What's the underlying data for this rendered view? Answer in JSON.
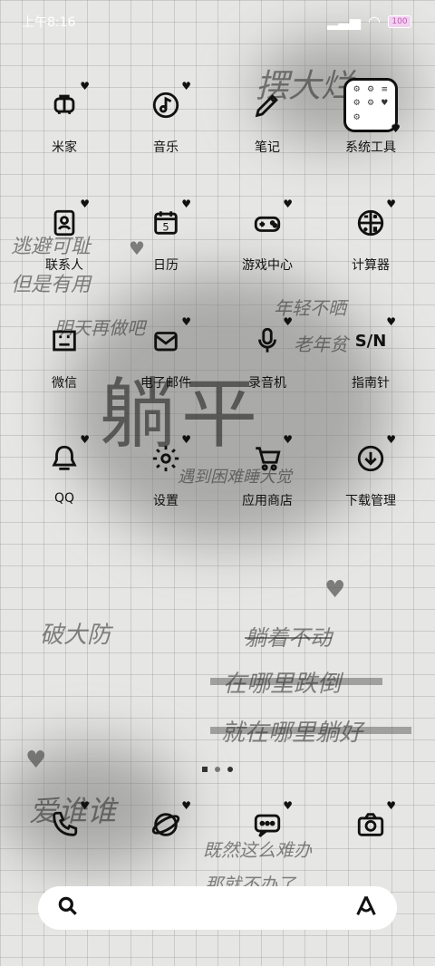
{
  "status": {
    "time": "上午8:16",
    "battery": "100"
  },
  "apps_row1": [
    {
      "label": "米家",
      "icon": "mijia-icon"
    },
    {
      "label": "音乐",
      "icon": "music-icon"
    },
    {
      "label": "笔记",
      "icon": "notes-icon"
    },
    {
      "label": "系统工具",
      "icon": "system-tools-folder-icon"
    }
  ],
  "apps_row2": [
    {
      "label": "联系人",
      "icon": "contacts-icon"
    },
    {
      "label": "日历",
      "icon": "calendar-icon",
      "day": "5"
    },
    {
      "label": "游戏中心",
      "icon": "gamepad-icon"
    },
    {
      "label": "计算器",
      "icon": "calculator-icon"
    }
  ],
  "apps_row3": [
    {
      "label": "微信",
      "icon": "wechat-icon"
    },
    {
      "label": "电子邮件",
      "icon": "email-icon"
    },
    {
      "label": "录音机",
      "icon": "microphone-icon"
    },
    {
      "label": "指南针",
      "icon": "compass-icon",
      "glyph": "S/N"
    }
  ],
  "apps_row4": [
    {
      "label": "QQ",
      "icon": "qq-icon"
    },
    {
      "label": "设置",
      "icon": "settings-gear-icon"
    },
    {
      "label": "应用商店",
      "icon": "shopping-cart-icon"
    },
    {
      "label": "下载管理",
      "icon": "download-icon"
    }
  ],
  "dock": [
    {
      "icon": "phone-icon"
    },
    {
      "icon": "browser-icon"
    },
    {
      "icon": "messages-icon"
    },
    {
      "icon": "camera-icon"
    }
  ],
  "wallpaper_text": {
    "t1": "摆大烂",
    "t2": "逃避可耻",
    "t3": "但是有用",
    "t4": "明天再做吧",
    "t5": "年轻不晒",
    "t6": "老年贫",
    "t7": "躺平",
    "t8": "遇到困难睡大觉",
    "t9": "破大防",
    "t10": "躺着不动",
    "t11": "在哪里跌倒",
    "t12": "就在哪里躺好",
    "t13": "爱谁谁",
    "t14": "既然这么难办",
    "t15": "那就不办了"
  }
}
